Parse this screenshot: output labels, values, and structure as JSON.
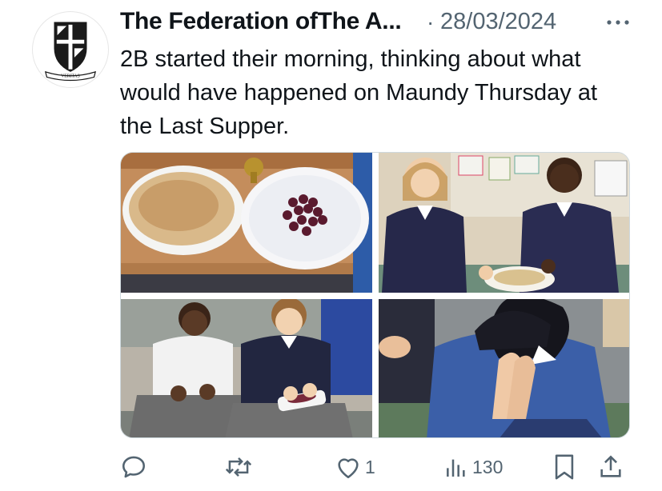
{
  "tweet": {
    "author_name": "The Federation ofThe A...",
    "separator": "·",
    "date": "28/03/2024",
    "text": "2B started their morning, thinking about what would have happened on Maundy Thursday at the Last Supper.",
    "avatar_motto": "VERITAS",
    "more_icon": "more-horizontal-icon"
  },
  "media": {
    "images": [
      {
        "subject": "flatbread and grapes on paper plates"
      },
      {
        "subject": "two pupils holding a plate of bread"
      },
      {
        "subject": "two pupils sitting holding grapes"
      },
      {
        "subject": "pupil with hands together in prayer"
      }
    ]
  },
  "actions": {
    "reply": {
      "icon": "reply-icon",
      "count": ""
    },
    "repost": {
      "icon": "repost-icon",
      "count": ""
    },
    "like": {
      "icon": "heart-icon",
      "count": "1"
    },
    "views": {
      "icon": "views-icon",
      "count": "130"
    },
    "bookmark": {
      "icon": "bookmark-icon"
    },
    "share": {
      "icon": "share-icon"
    }
  },
  "colors": {
    "text": "#0f1419",
    "secondary": "#536471",
    "border": "#cfd9de"
  }
}
